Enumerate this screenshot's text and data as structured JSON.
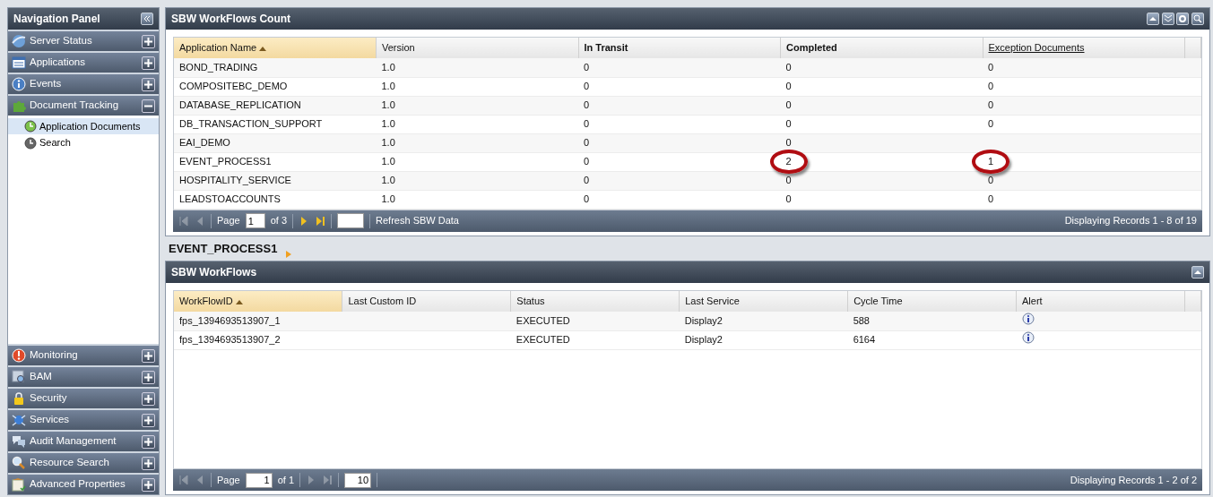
{
  "navigation": {
    "title": "Navigation Panel",
    "sections": [
      {
        "label": "Server Status",
        "expanded": false
      },
      {
        "label": "Applications",
        "expanded": false
      },
      {
        "label": "Events",
        "expanded": false
      },
      {
        "label": "Document Tracking",
        "expanded": true,
        "children": [
          {
            "label": "Application Documents",
            "selected": true
          },
          {
            "label": "Search",
            "selected": false
          }
        ]
      },
      {
        "label": "Monitoring",
        "expanded": false
      },
      {
        "label": "BAM",
        "expanded": false
      },
      {
        "label": "Security",
        "expanded": false
      },
      {
        "label": "Services",
        "expanded": false
      },
      {
        "label": "Audit Management",
        "expanded": false
      },
      {
        "label": "Resource Search",
        "expanded": false
      },
      {
        "label": "Advanced Properties",
        "expanded": false
      }
    ]
  },
  "count_panel": {
    "title": "SBW WorkFlows Count",
    "columns": [
      {
        "label": "Application Name",
        "sorted": true,
        "bold": false,
        "underlined": false
      },
      {
        "label": "Version",
        "sorted": false,
        "bold": false,
        "underlined": false
      },
      {
        "label": "In Transit",
        "sorted": false,
        "bold": true,
        "underlined": false
      },
      {
        "label": "Completed",
        "sorted": false,
        "bold": true,
        "underlined": false
      },
      {
        "label": "Exception Documents",
        "sorted": false,
        "bold": false,
        "underlined": true
      }
    ],
    "rows": [
      {
        "cells": [
          {
            "text": "BOND_TRADING"
          },
          {
            "text": "1.0"
          },
          {
            "text": "0"
          },
          {
            "text": "0"
          },
          {
            "text": "0"
          }
        ]
      },
      {
        "cells": [
          {
            "text": "COMPOSITEBC_DEMO"
          },
          {
            "text": "1.0"
          },
          {
            "text": "0"
          },
          {
            "text": "0"
          },
          {
            "text": "0"
          }
        ]
      },
      {
        "cells": [
          {
            "text": "DATABASE_REPLICATION"
          },
          {
            "text": "1.0"
          },
          {
            "text": "0"
          },
          {
            "text": "0"
          },
          {
            "text": "0"
          }
        ]
      },
      {
        "cells": [
          {
            "text": "DB_TRANSACTION_SUPPORT"
          },
          {
            "text": "1.0"
          },
          {
            "text": "0"
          },
          {
            "text": "0"
          },
          {
            "text": "0"
          }
        ]
      },
      {
        "cells": [
          {
            "text": "EAI_DEMO"
          },
          {
            "text": "1.0"
          },
          {
            "text": "0"
          },
          {
            "text": "0"
          },
          {}
        ]
      },
      {
        "cells": [
          {
            "text": "EVENT_PROCESS1"
          },
          {
            "text": "1.0"
          },
          {
            "text": "0"
          },
          {
            "text": "2",
            "circled": true
          },
          {
            "text": "1",
            "circled": true
          }
        ]
      },
      {
        "cells": [
          {
            "text": "HOSPITALITY_SERVICE"
          },
          {
            "text": "1.0"
          },
          {
            "text": "0"
          },
          {
            "text": "0"
          },
          {
            "text": "0"
          }
        ]
      },
      {
        "cells": [
          {
            "text": "LEADSTOACCOUNTS"
          },
          {
            "text": "1.0"
          },
          {
            "text": "0"
          },
          {
            "text": "0"
          },
          {
            "text": "0"
          }
        ]
      }
    ],
    "pager": {
      "page_label": "Page",
      "page": "1",
      "of": "of 3",
      "back_enabled": false,
      "forward_enabled": true,
      "refresh": "Refresh SBW Data",
      "status": "Displaying Records 1 - 8 of 19"
    }
  },
  "breadcrumb": "EVENT_PROCESS1",
  "workflows_panel": {
    "title": "SBW WorkFlows",
    "columns": [
      {
        "label": "WorkFlowID",
        "sorted": true,
        "bold": false,
        "underlined": false
      },
      {
        "label": "Last Custom ID",
        "sorted": false,
        "bold": false,
        "underlined": false
      },
      {
        "label": "Status",
        "sorted": false,
        "bold": false,
        "underlined": false
      },
      {
        "label": "Last Service",
        "sorted": false,
        "bold": false,
        "underlined": false
      },
      {
        "label": "Cycle Time",
        "sorted": false,
        "bold": false,
        "underlined": false
      },
      {
        "label": "Alert",
        "sorted": false,
        "bold": false,
        "underlined": false
      }
    ],
    "rows": [
      {
        "cells": [
          {
            "text": "fps_1394693513907_1"
          },
          {},
          {
            "text": "EXECUTED"
          },
          {
            "text": "Display2"
          },
          {
            "text": "588"
          },
          {
            "kind": "info"
          }
        ]
      },
      {
        "cells": [
          {
            "text": "fps_1394693513907_2"
          },
          {},
          {
            "text": "EXECUTED"
          },
          {
            "text": "Display2"
          },
          {
            "text": "6164"
          },
          {
            "kind": "info"
          }
        ]
      }
    ],
    "pager": {
      "page_label": "Page",
      "page": "1",
      "of": "of 1",
      "page_size": "10",
      "back_enabled": false,
      "forward_enabled": false,
      "status": "Displaying Records 1 - 2 of 2"
    }
  }
}
